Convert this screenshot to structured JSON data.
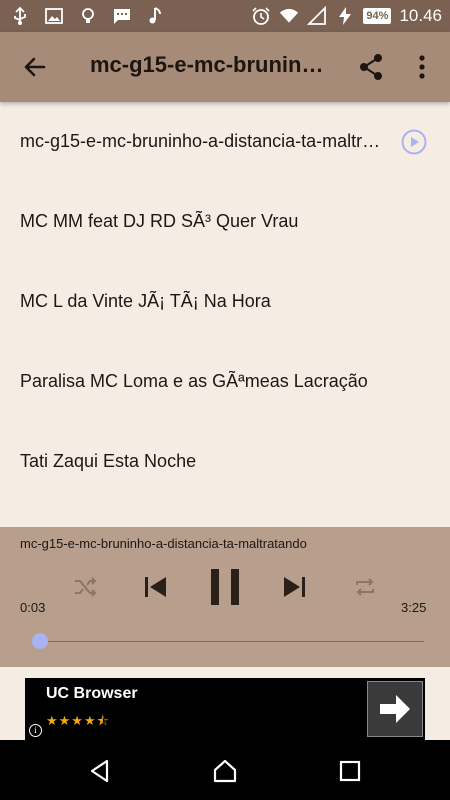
{
  "status_bar": {
    "battery": "94%",
    "time": "10.46"
  },
  "app_bar": {
    "title": "mc-g15-e-mc-bruninho-a-distancia-ta-maltratando",
    "back_icon": "arrow-back-icon",
    "share_icon": "share-icon",
    "more_icon": "more-vert-icon"
  },
  "tracks": [
    {
      "title": "mc-g15-e-mc-bruninho-a-distancia-ta-maltratando",
      "playing": true
    },
    {
      "title": "MC MM feat DJ RD SÃ³ Quer Vrau"
    },
    {
      "title": "MC L da Vinte JÃ¡ TÃ¡ Na Hora"
    },
    {
      "title": "Paralisa MC Loma e as GÃªmeas Lacração"
    },
    {
      "title": "Tati Zaqui Esta Noche"
    }
  ],
  "player": {
    "now_playing": "mc-g15-e-mc-bruninho-a-distancia-ta-maltratando",
    "elapsed": "0:03",
    "duration": "3:25",
    "progress_fraction": 0.015,
    "accent": "#aab3f2",
    "progress_color": "#c2504a"
  },
  "ad": {
    "app_name": "UC Browser",
    "stars": "★★★★⯪",
    "rating": 4.5,
    "info_label": "i"
  },
  "colors": {
    "status_bar": "#7a6152",
    "app_bar": "#a58b78",
    "background": "#f5ede4",
    "player": "#b79e8d"
  }
}
